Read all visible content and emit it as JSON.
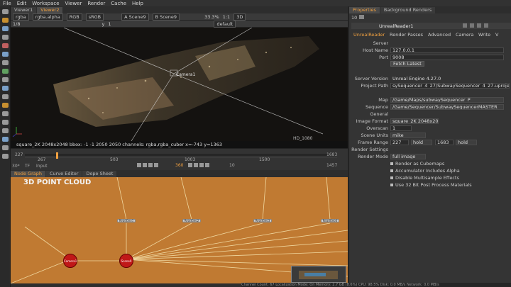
{
  "menu": [
    "File",
    "Edit",
    "Workspace",
    "Viewer",
    "Render",
    "Cache",
    "Help"
  ],
  "viewer": {
    "tabs": [
      "Viewer1",
      "Viewer2"
    ],
    "toolbar": {
      "channels": "rgba",
      "layer": "rgba.alpha",
      "colorspace": "RGB",
      "lut": "sRGB",
      "input_a": "A Scene9",
      "input_b": "B Scene9",
      "zoom": "33.3%",
      "ratio": "1:1",
      "mode": "3D"
    },
    "toolbar2": {
      "frame": "1/8",
      "y_label": "y",
      "y_val": "1",
      "camera": "default"
    },
    "camera_label": "Camera1",
    "format_label": "HD_1080",
    "info": "square_2K 2048x2048  bbox: -1 -1 2050 2050 channels: rgba,rgba_cuber x=-743 y=1363"
  },
  "timeline": {
    "start": "227",
    "end": "1683",
    "current": "360",
    "fps_label": "30*",
    "tf_label": "TF",
    "input_label": "Input",
    "step": "10",
    "end2": "1457",
    "ticks": [
      "267",
      "503",
      "1003",
      "1500"
    ]
  },
  "panels": {
    "tabs": [
      "Node Graph",
      "Curve Editor",
      "Dope Sheet"
    ],
    "title": "3D POINT CLOUD",
    "nodes": [
      "ReadGeo1",
      "ReadGeo2",
      "ReadGeo3",
      "ReadGeo4"
    ],
    "camera_node": "Camera1",
    "scene_node": "Scene9"
  },
  "status": "Channel Count: 67 Localization Mode: On Memory: 2.7 GB (8.6%) CPU: 98.5% Disk: 0.0 MB/s Network: 0.0 MB/s",
  "props": {
    "tabs": [
      "Properties",
      "Background Renders"
    ],
    "count": "10",
    "node_name": "UnrealReader1",
    "subtabs": [
      "UnrealReader",
      "Render Passes",
      "Advanced",
      "Camera",
      "Write",
      "V"
    ],
    "fields": [
      {
        "label": "Server",
        "value": ""
      },
      {
        "label": "Host Name",
        "value": "127.0.0.1"
      },
      {
        "label": "Port",
        "value": "9008"
      }
    ],
    "fetch_label": "Fetch Latest",
    "server_version_label": "Server Version",
    "server_version": "Unreal Engine 4.27.0",
    "project_path_label": "Project Path",
    "project_path": "sySequencer_4_27/SubwaySequencer_4_27.uproject",
    "map_label": "Map",
    "map": "/Game/Maps/subwaySequencer_P",
    "sequence_label": "Sequence",
    "sequence": "/Game/Sequencer/SubwaySequencerMASTER",
    "general_label": "General",
    "image_format_label": "Image Format",
    "image_format": "square_2K 2048x2048",
    "overscan_label": "Overscan",
    "overscan": "1",
    "scene_units_label": "Scene Units",
    "scene_units": "mike",
    "frame_range_label": "Frame Range",
    "frame_start": "227",
    "frame_hold1": "hold",
    "frame_end": "1683",
    "frame_hold2": "hold",
    "render_settings_label": "Render Settings",
    "render_mode_label": "Render Mode",
    "render_mode": "full image",
    "checks": [
      "Render as Cubemaps",
      "Accumulator Includes Alpha",
      "Disable Multisample Effects",
      "Use 32 Bit Post Process Materials"
    ]
  }
}
